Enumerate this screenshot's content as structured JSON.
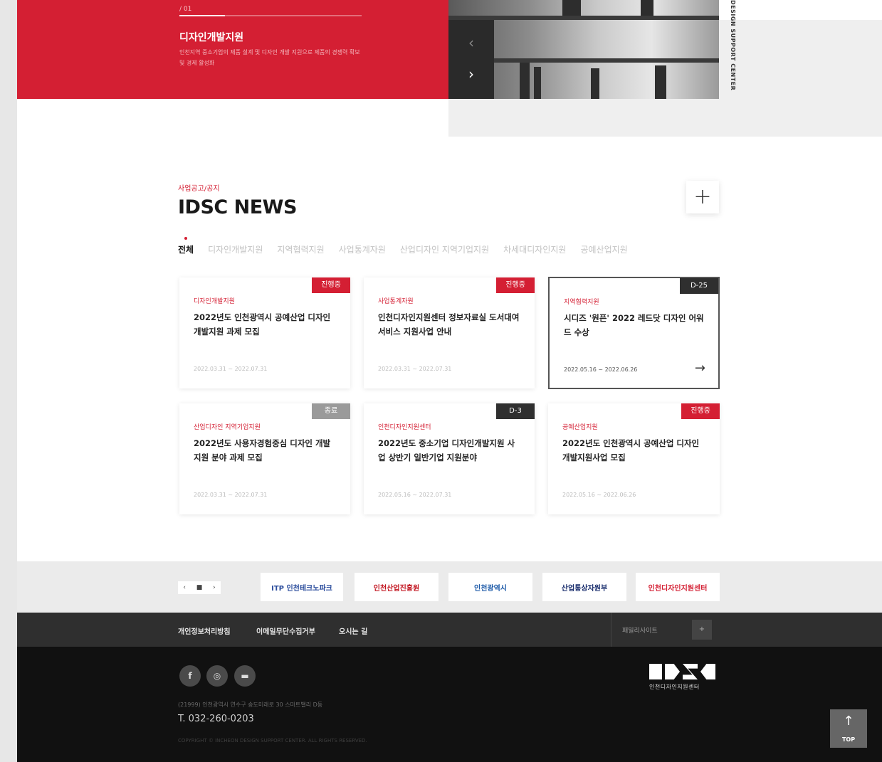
{
  "hero": {
    "counter": "/ 01",
    "progress_fraction": 0.25,
    "title": "디자인개발지원",
    "description": "인천지역 중소기업의 제품 설계 및 디자인 개발 지원으로 제품의 경쟁력 확보 및 경제 활성화",
    "prev_label": "‹",
    "next_label": "›",
    "vertical_text": "DESIGN SUPPORT CENTER"
  },
  "news": {
    "eyebrow": "사업공고/공지",
    "title": "IDSC NEWS",
    "more_label": "+",
    "tabs": [
      "전체",
      "디자인개발지원",
      "지역협력지원",
      "사업통계자원",
      "산업디자인 지역기업지원",
      "차세대디자인지원",
      "공예산업지원"
    ],
    "cards": [
      {
        "badge": "진행중",
        "badge_color": "#d41f33",
        "category": "디자인개발지원",
        "title": "2022년도 인천광역시 공예산업 디자인개발지원 과제 모집",
        "date": "2022.03.31 ~ 2022.07.31"
      },
      {
        "badge": "진행중",
        "badge_color": "#d41f33",
        "category": "사업통계자원",
        "title": "인천디자인지원센터 정보자료실 도서대여 서비스 지원사업 안내",
        "date": "2022.03.31 ~ 2022.07.31"
      },
      {
        "badge": "D-25",
        "badge_color": "#2f2f2f",
        "category": "지역협력지원",
        "title": "시디즈 '원픈' 2022 레드닷 디자인 어워드 수상",
        "date": "2022.05.16 ~ 2022.06.26",
        "arrow": "→"
      },
      {
        "badge": "종료",
        "badge_color": "#9a9a9a",
        "category": "산업디자인 지역기업지원",
        "title": "2022년도 사용자경험중심 디자인 개발지원 분야 과제 모집",
        "date": "2022.03.31 ~ 2022.07.31"
      },
      {
        "badge": "D-3",
        "badge_color": "#2f2f2f",
        "category": "인천디자인지원센터",
        "title": "2022년도 중소기업 디자인개발지원 사업 상반기 일반기업 지원분야",
        "date": "2022.05.16 ~ 2022.07.31"
      },
      {
        "badge": "진행중",
        "badge_color": "#d41f33",
        "category": "공예산업지원",
        "title": "2022년도 인천광역시 공예산업 디자인개발지원사업 모집",
        "date": "2022.05.16 ~ 2022.06.26"
      }
    ]
  },
  "partners": {
    "pager": [
      "‹",
      "■",
      "›"
    ],
    "items": [
      {
        "label": "ITP 인천테크노파크",
        "color": "#2a4c9c"
      },
      {
        "label": "인천산업진흥원",
        "color": "#c2141f"
      },
      {
        "label": "인천광역시",
        "color": "#1d5aa8"
      },
      {
        "label": "산업통상자원부",
        "color": "#1b2f6e"
      },
      {
        "label": "인천디자인지원센터",
        "color": "#d41f33"
      }
    ]
  },
  "footer": {
    "links": [
      "개인정보처리방침",
      "이메일무단수집거부",
      "오시는 길"
    ],
    "family_site": "패밀리사이트",
    "family_btn": "+",
    "social": [
      {
        "label": "f",
        "icon": "facebook-icon"
      },
      {
        "label": "◎",
        "icon": "instagram-icon"
      },
      {
        "label": "▬",
        "icon": "blog-icon"
      }
    ],
    "address": "(21999) 인천광역시 연수구 송도미래로 30 스마트밸리 D동",
    "tel": "T. 032-260-0203",
    "copyright": "COPYRIGHT © INCHEON DESIGN SUPPORT CENTER. ALL RIGHTS RESERVED.",
    "logo_text": "인천디자인지원센터",
    "top_label": "TOP",
    "top_arrow": "↑"
  }
}
